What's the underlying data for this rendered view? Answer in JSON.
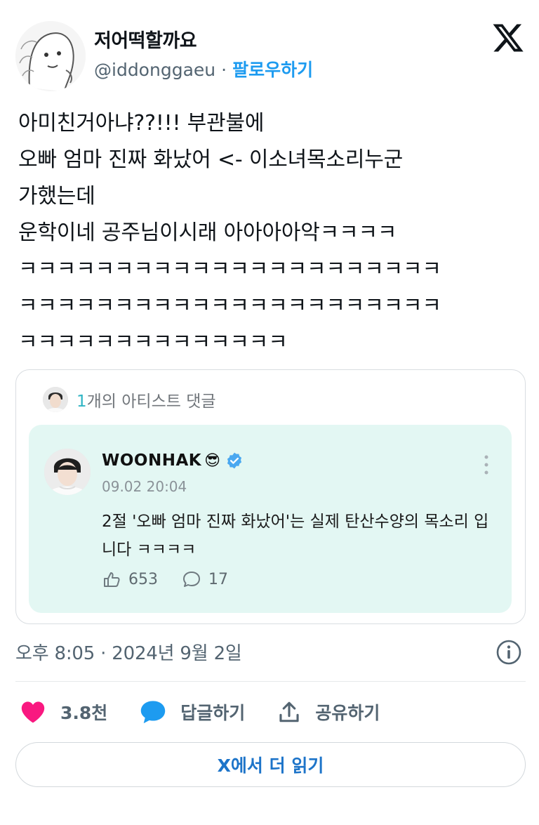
{
  "author": {
    "name": "저어떡할까요",
    "handle": "@iddonggaeu",
    "separator": "·",
    "follow_label": "팔로우하기"
  },
  "tweet": {
    "lines": [
      "아미친거아냐??!!! 부관불에",
      "오빠 엄마 진짜 화났어 <- 이소녀목소리누군",
      "가했는데",
      "운학이네 공주님이시래 아아아아악ㅋㅋㅋㅋ",
      "ㅋㅋㅋㅋㅋㅋㅋㅋㅋㅋㅋㅋㅋㅋㅋㅋㅋㅋㅋㅋㅋㅋ",
      "ㅋㅋㅋㅋㅋㅋㅋㅋㅋㅋㅋㅋㅋㅋㅋㅋㅋㅋㅋㅋㅋㅋ",
      "ㅋㅋㅋㅋㅋㅋㅋㅋㅋㅋㅋㅋㅋㅋ"
    ],
    "timestamp": "오후 8:05 · 2024년 9월 2일"
  },
  "card": {
    "count": "1",
    "header_suffix": "개의 아티스트 댓글",
    "comment": {
      "author": "WOONHAK",
      "emoji": "😎",
      "date": "09.02 20:04",
      "body": "2절 '오빠 엄마 진짜 화났어'는 실제 탄산수양의 목소리 입니다 ㅋㅋㅋㅋ",
      "likes": "653",
      "replies": "17"
    }
  },
  "actions": {
    "like_count": "3.8천",
    "reply_label": "답글하기",
    "share_label": "공유하기"
  },
  "read_more_label": "X에서 더 읽기",
  "colors": {
    "accent": "#1d9bf0",
    "heart": "#f91880",
    "comment_bg": "#e3f7f3",
    "artist_count": "#2fb4c4"
  },
  "icons": [
    "x-logo-icon",
    "verified-icon",
    "more-icon",
    "like-icon",
    "reply-icon",
    "heart-icon",
    "chat-bubble-icon",
    "share-icon",
    "info-icon"
  ]
}
